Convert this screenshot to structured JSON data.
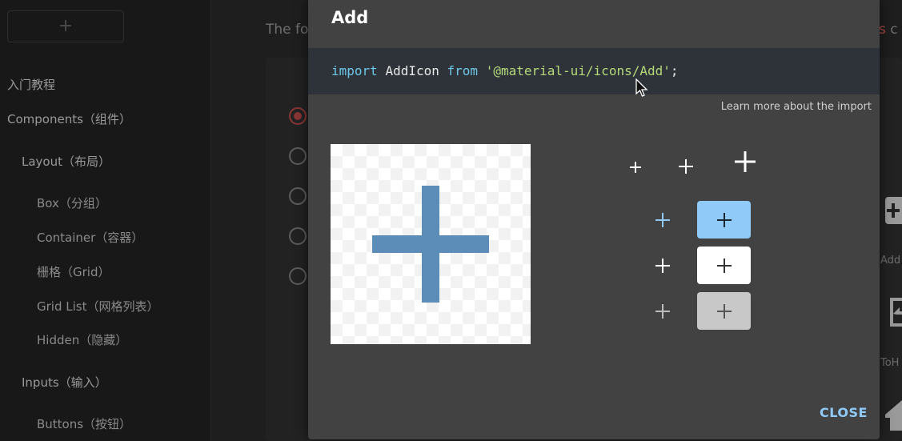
{
  "sidebar": {
    "logo_symbol": "+",
    "items": [
      {
        "label": "入门教程"
      },
      {
        "label": "Components（组件）"
      },
      {
        "label": "Layout（布局）"
      },
      {
        "label": "Box（分组）"
      },
      {
        "label": "Container（容器）"
      },
      {
        "label": "栅格（Grid）"
      },
      {
        "label": "Grid List（网格列表）"
      },
      {
        "label": "Hidden（隐藏）"
      },
      {
        "label": "Inputs（输入）"
      },
      {
        "label": "Buttons（按钮）"
      }
    ]
  },
  "main": {
    "intro_fragment": "The fo",
    "right_fragment_red": "s",
    "right_fragment": " c",
    "right_labels": [
      "Add",
      "ToH"
    ]
  },
  "dialog": {
    "title": "Add",
    "import_code": {
      "kw_import": "import",
      "ident": "AddIcon",
      "kw_from": "from",
      "module": "'@material-ui/icons/Add'",
      "semicolon": ";"
    },
    "learn_more": "Learn more about the import",
    "close_label": "CLOSE"
  },
  "colors": {
    "preview_icon": "#5b8db8",
    "primary_icon": "#90caf9",
    "button_light_blue": "#90caf9",
    "button_white": "#ffffff",
    "button_grey": "#c8c8c8",
    "close_text": "#90caf9"
  },
  "icons": [
    "add-icon",
    "cursor-icon",
    "radio-icon"
  ]
}
